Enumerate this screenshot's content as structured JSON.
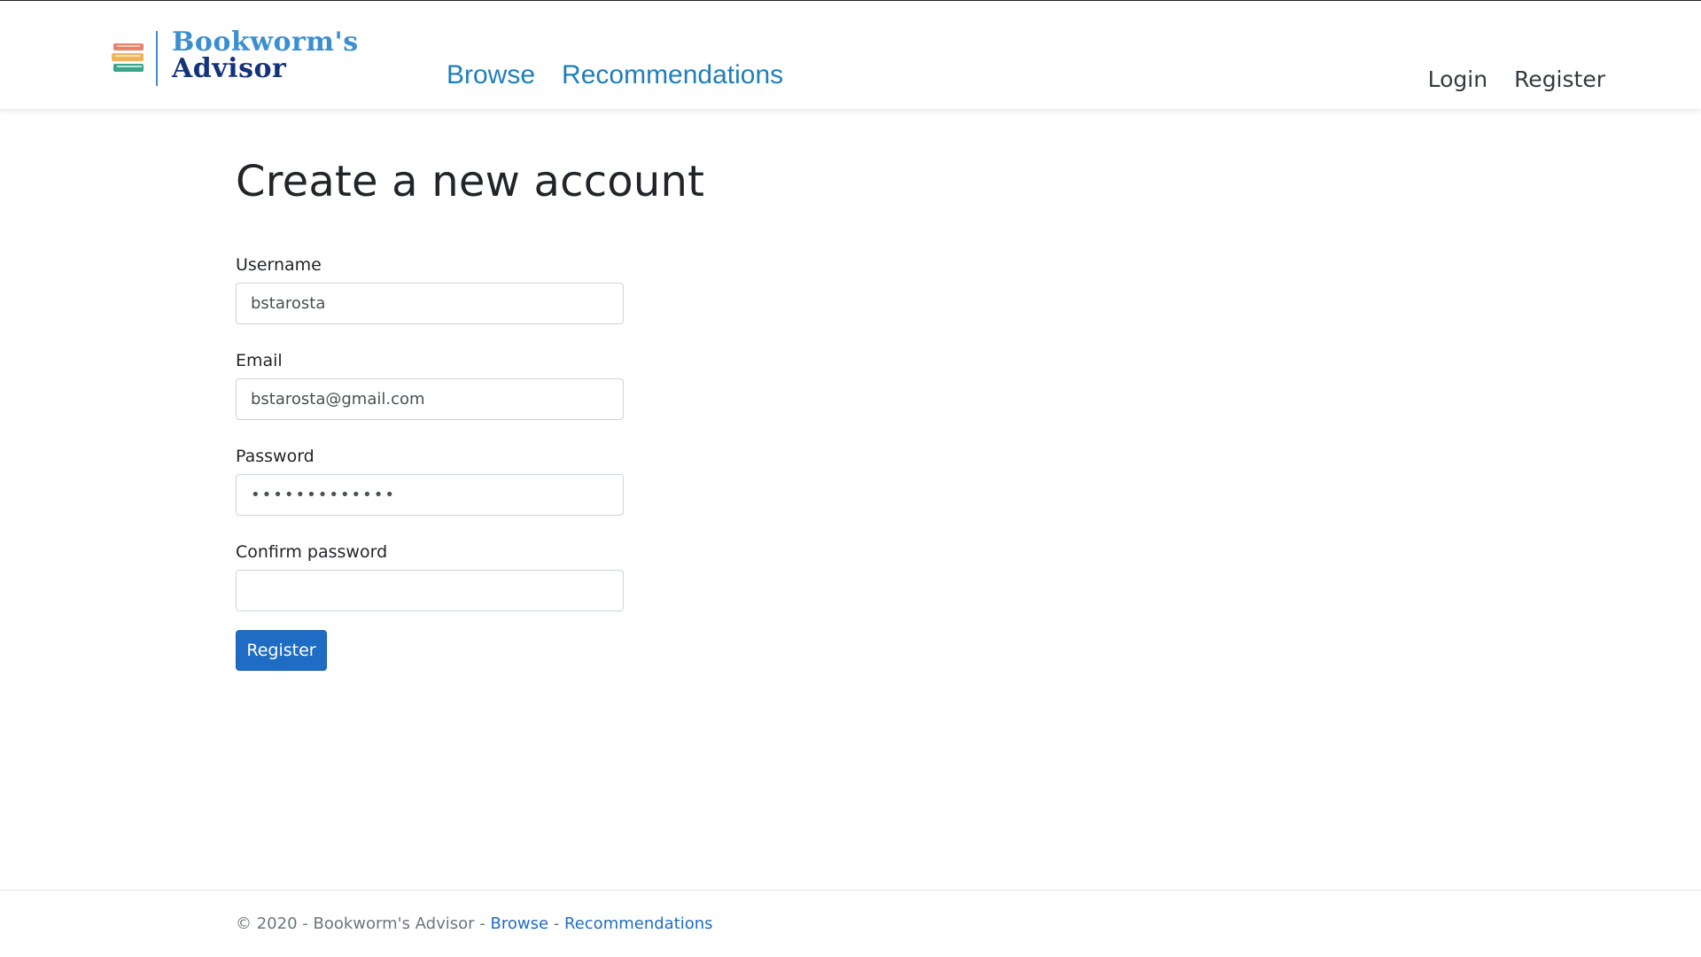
{
  "brand": {
    "line1": "Bookworm's",
    "line2": "Advisor",
    "icon": "books-stack-icon",
    "colors": {
      "primary": "#3b8fd0",
      "dark": "#14337a"
    }
  },
  "main_nav": {
    "browse": "Browse",
    "recommendations": "Recommendations"
  },
  "auth_nav": {
    "login": "Login",
    "register": "Register"
  },
  "page": {
    "title": "Create a new account"
  },
  "form": {
    "username": {
      "label": "Username",
      "value": "bstarosta"
    },
    "email": {
      "label": "Email",
      "value": "bstarosta@gmail.com"
    },
    "password": {
      "label": "Password",
      "value": "bstarosta1234"
    },
    "confirm_password": {
      "label": "Confirm password",
      "value": ""
    },
    "submit_label": "Register"
  },
  "footer": {
    "copyright": "© 2020 - Bookworm's Advisor -",
    "separator": "-",
    "browse": "Browse",
    "recommendations": "Recommendations"
  },
  "colors": {
    "link": "#1f7fb8",
    "button": "#1f6cc4"
  }
}
